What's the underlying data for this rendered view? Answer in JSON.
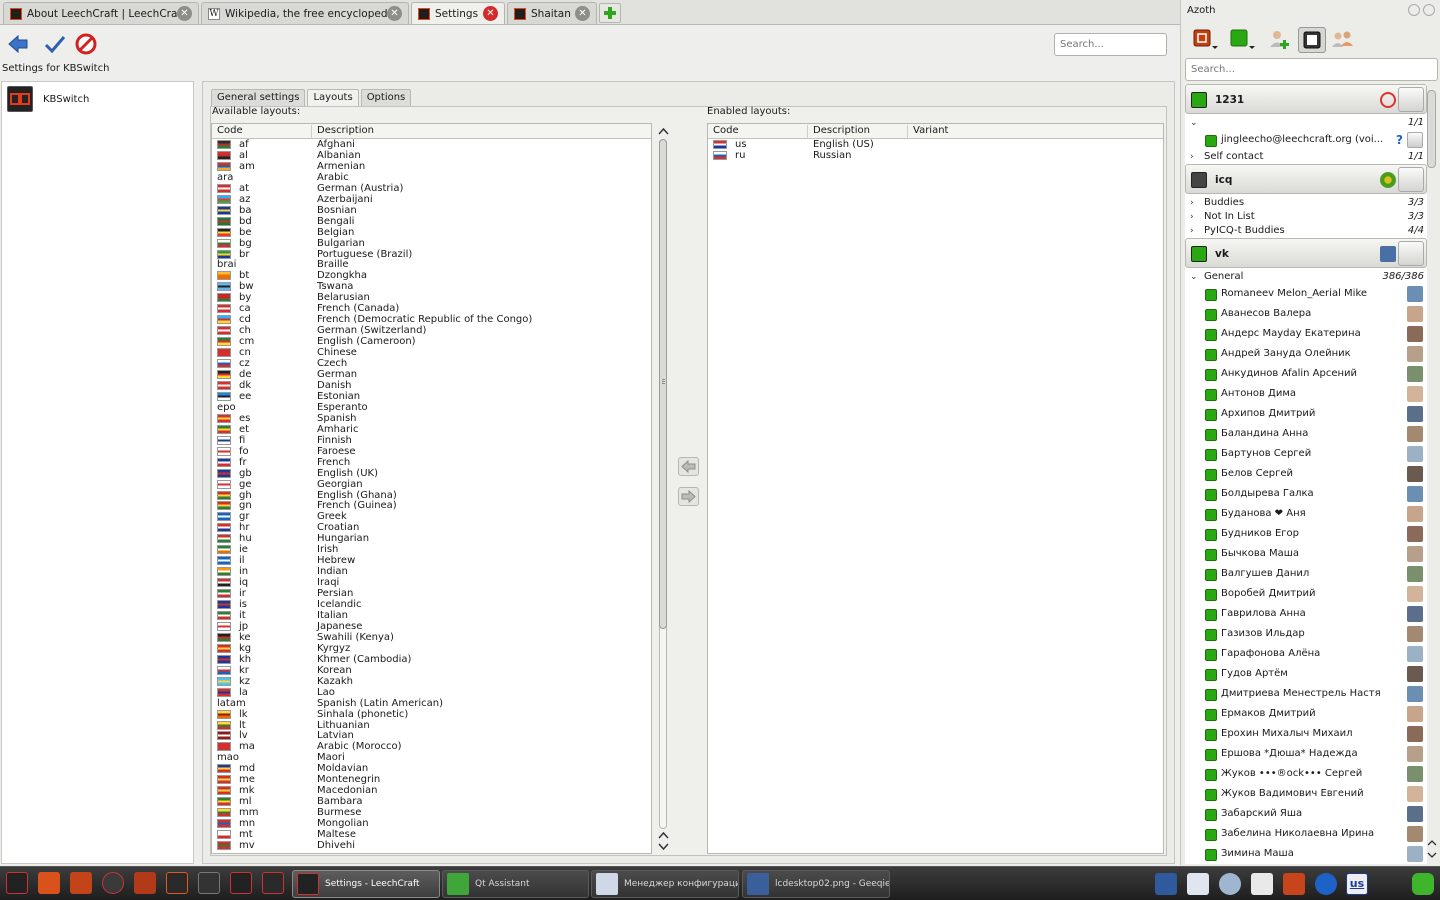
{
  "browser_tabs": [
    {
      "label": "About LeechCraft | LeechCraft"
    },
    {
      "label": "Wikipedia, the free encyclopedia"
    },
    {
      "label": "Settings"
    },
    {
      "label": "Shaitan"
    }
  ],
  "toolbar": {
    "search_placeholder": "Search..."
  },
  "settings_for": "Settings for KBSwitch",
  "left_panel": {
    "item_label": "KBSwitch"
  },
  "settings_tabs": [
    "General settings",
    "Layouts",
    "Options"
  ],
  "available": {
    "group_label": "Available layouts:",
    "columns": [
      "Code",
      "Description"
    ],
    "rows": [
      {
        "code": "af",
        "desc": "Afghani",
        "flag": [
          "#2b2b2b",
          "#c62828",
          "#2e7d32"
        ]
      },
      {
        "code": "al",
        "desc": "Albanian",
        "flag": [
          "#d32f2f",
          "#c62828",
          "#212121"
        ]
      },
      {
        "code": "am",
        "desc": "Armenian",
        "flag": [
          "#d32f2f",
          "#1565c0",
          "#f9a825"
        ]
      },
      {
        "code": "ara",
        "desc": "Arabic",
        "noflag": true
      },
      {
        "code": "at",
        "desc": "German (Austria)",
        "flag": [
          "#d32f2f",
          "#ffffff",
          "#d32f2f"
        ]
      },
      {
        "code": "az",
        "desc": "Azerbaijani",
        "flag": [
          "#29b6f6",
          "#e53935",
          "#43a047"
        ]
      },
      {
        "code": "ba",
        "desc": "Bosnian",
        "flag": [
          "#1a3a99",
          "#fdd835",
          "#1a3a99"
        ]
      },
      {
        "code": "bd",
        "desc": "Bengali",
        "flag": [
          "#1b7a32",
          "#d32f2f",
          "#1b7a32"
        ]
      },
      {
        "code": "be",
        "desc": "Belgian",
        "flag": [
          "#212121",
          "#fdd835",
          "#e53935"
        ]
      },
      {
        "code": "bg",
        "desc": "Bulgarian",
        "flag": [
          "#ffffff",
          "#2e7d32",
          "#d32f2f"
        ]
      },
      {
        "code": "br",
        "desc": "Portuguese (Brazil)",
        "flag": [
          "#2e9d3a",
          "#fdd835",
          "#1a3a99"
        ]
      },
      {
        "code": "brai",
        "desc": "Braille",
        "noflag": true
      },
      {
        "code": "bt",
        "desc": "Dzongkha",
        "flag": [
          "#fbc02d",
          "#ef6c00",
          "#ef6c00"
        ]
      },
      {
        "code": "bw",
        "desc": "Tswana",
        "flag": [
          "#64b5f6",
          "#212121",
          "#64b5f6"
        ]
      },
      {
        "code": "by",
        "desc": "Belarusian",
        "flag": [
          "#c62828",
          "#c62828",
          "#2e7d32"
        ]
      },
      {
        "code": "ca",
        "desc": "French (Canada)",
        "flag": [
          "#d32f2f",
          "#ffffff",
          "#d32f2f"
        ]
      },
      {
        "code": "cd",
        "desc": "French (Democratic Republic of the Congo)",
        "flag": [
          "#29b6f6",
          "#d32f2f",
          "#fdd835"
        ]
      },
      {
        "code": "ch",
        "desc": "German (Switzerland)",
        "flag": [
          "#d32f2f",
          "#ffffff",
          "#d32f2f"
        ]
      },
      {
        "code": "cm",
        "desc": "English (Cameroon)",
        "flag": [
          "#2e7d32",
          "#d32f2f",
          "#fdd835"
        ]
      },
      {
        "code": "cn",
        "desc": "Chinese",
        "flag": [
          "#d32f2f",
          "#d32f2f",
          "#d32f2f"
        ]
      },
      {
        "code": "cz",
        "desc": "Czech",
        "flag": [
          "#ffffff",
          "#1565c0",
          "#d32f2f"
        ]
      },
      {
        "code": "de",
        "desc": "German",
        "flag": [
          "#212121",
          "#d32f2f",
          "#fdd835"
        ]
      },
      {
        "code": "dk",
        "desc": "Danish",
        "flag": [
          "#d32f2f",
          "#ffffff",
          "#d32f2f"
        ]
      },
      {
        "code": "ee",
        "desc": "Estonian",
        "flag": [
          "#1e88e5",
          "#212121",
          "#ffffff"
        ]
      },
      {
        "code": "epo",
        "desc": "Esperanto",
        "noflag": true
      },
      {
        "code": "es",
        "desc": "Spanish",
        "flag": [
          "#d32f2f",
          "#fdd835",
          "#d32f2f"
        ]
      },
      {
        "code": "et",
        "desc": "Amharic",
        "flag": [
          "#2e7d32",
          "#fdd835",
          "#d32f2f"
        ]
      },
      {
        "code": "fi",
        "desc": "Finnish",
        "flag": [
          "#ffffff",
          "#1a3a99",
          "#ffffff"
        ]
      },
      {
        "code": "fo",
        "desc": "Faroese",
        "flag": [
          "#ffffff",
          "#d32f2f",
          "#ffffff"
        ]
      },
      {
        "code": "fr",
        "desc": "French",
        "flag": [
          "#1a3a99",
          "#ffffff",
          "#d32f2f"
        ]
      },
      {
        "code": "gb",
        "desc": "English (UK)",
        "flag": [
          "#1a3a99",
          "#d32f2f",
          "#1a3a99"
        ]
      },
      {
        "code": "ge",
        "desc": "Georgian",
        "flag": [
          "#ffffff",
          "#d32f2f",
          "#ffffff"
        ]
      },
      {
        "code": "gh",
        "desc": "English (Ghana)",
        "flag": [
          "#d32f2f",
          "#fdd835",
          "#2e7d32"
        ]
      },
      {
        "code": "gn",
        "desc": "French (Guinea)",
        "flag": [
          "#d32f2f",
          "#fdd835",
          "#2e7d32"
        ]
      },
      {
        "code": "gr",
        "desc": "Greek",
        "flag": [
          "#1565c0",
          "#ffffff",
          "#1565c0"
        ]
      },
      {
        "code": "hr",
        "desc": "Croatian",
        "flag": [
          "#d32f2f",
          "#ffffff",
          "#1a3a99"
        ]
      },
      {
        "code": "hu",
        "desc": "Hungarian",
        "flag": [
          "#d32f2f",
          "#ffffff",
          "#2e7d32"
        ]
      },
      {
        "code": "ie",
        "desc": "Irish",
        "flag": [
          "#2e7d32",
          "#ffffff",
          "#ef6c00"
        ]
      },
      {
        "code": "il",
        "desc": "Hebrew",
        "flag": [
          "#1565c0",
          "#ffffff",
          "#1565c0"
        ]
      },
      {
        "code": "in",
        "desc": "Indian",
        "flag": [
          "#ff9800",
          "#ffffff",
          "#2e7d32"
        ]
      },
      {
        "code": "iq",
        "desc": "Iraqi",
        "flag": [
          "#d32f2f",
          "#ffffff",
          "#212121"
        ]
      },
      {
        "code": "ir",
        "desc": "Persian",
        "flag": [
          "#2e7d32",
          "#ffffff",
          "#d32f2f"
        ]
      },
      {
        "code": "is",
        "desc": "Icelandic",
        "flag": [
          "#1a3a99",
          "#d32f2f",
          "#1a3a99"
        ]
      },
      {
        "code": "it",
        "desc": "Italian",
        "flag": [
          "#2e7d32",
          "#ffffff",
          "#d32f2f"
        ]
      },
      {
        "code": "jp",
        "desc": "Japanese",
        "flag": [
          "#ffffff",
          "#d32f2f",
          "#ffffff"
        ]
      },
      {
        "code": "ke",
        "desc": "Swahili (Kenya)",
        "flag": [
          "#212121",
          "#d32f2f",
          "#2e7d32"
        ]
      },
      {
        "code": "kg",
        "desc": "Kyrgyz",
        "flag": [
          "#d32f2f",
          "#fdd835",
          "#d32f2f"
        ]
      },
      {
        "code": "kh",
        "desc": "Khmer (Cambodia)",
        "flag": [
          "#1a3a99",
          "#d32f2f",
          "#1a3a99"
        ]
      },
      {
        "code": "kr",
        "desc": "Korean",
        "flag": [
          "#ffffff",
          "#d32f2f",
          "#1565c0"
        ]
      },
      {
        "code": "kz",
        "desc": "Kazakh",
        "flag": [
          "#4fc3f7",
          "#fdd835",
          "#4fc3f7"
        ]
      },
      {
        "code": "la",
        "desc": "Lao",
        "flag": [
          "#d32f2f",
          "#1a3a99",
          "#d32f2f"
        ]
      },
      {
        "code": "latam",
        "desc": "Spanish (Latin American)",
        "noflag": true
      },
      {
        "code": "lk",
        "desc": "Sinhala (phonetic)",
        "flag": [
          "#fdd835",
          "#8d1b1b",
          "#ef6c00"
        ]
      },
      {
        "code": "lt",
        "desc": "Lithuanian",
        "flag": [
          "#fdd835",
          "#2e7d32",
          "#d32f2f"
        ]
      },
      {
        "code": "lv",
        "desc": "Latvian",
        "flag": [
          "#8d1b1b",
          "#ffffff",
          "#8d1b1b"
        ]
      },
      {
        "code": "ma",
        "desc": "Arabic (Morocco)",
        "flag": [
          "#d32f2f",
          "#d32f2f",
          "#d32f2f"
        ]
      },
      {
        "code": "mao",
        "desc": "Maori",
        "noflag": true
      },
      {
        "code": "md",
        "desc": "Moldavian",
        "flag": [
          "#1a3a99",
          "#fdd835",
          "#d32f2f"
        ]
      },
      {
        "code": "me",
        "desc": "Montenegrin",
        "flag": [
          "#d32f2f",
          "#fdd835",
          "#d32f2f"
        ]
      },
      {
        "code": "mk",
        "desc": "Macedonian",
        "flag": [
          "#d32f2f",
          "#fdd835",
          "#d32f2f"
        ]
      },
      {
        "code": "ml",
        "desc": "Bambara",
        "flag": [
          "#2e7d32",
          "#fdd835",
          "#d32f2f"
        ]
      },
      {
        "code": "mm",
        "desc": "Burmese",
        "flag": [
          "#fdd835",
          "#2e7d32",
          "#d32f2f"
        ]
      },
      {
        "code": "mn",
        "desc": "Mongolian",
        "flag": [
          "#d32f2f",
          "#1565c0",
          "#d32f2f"
        ]
      },
      {
        "code": "mt",
        "desc": "Maltese",
        "flag": [
          "#ffffff",
          "#ffffff",
          "#d32f2f"
        ]
      },
      {
        "code": "mv",
        "desc": "Dhivehi",
        "flag": [
          "#d32f2f",
          "#2e7d32",
          "#d32f2f"
        ]
      }
    ]
  },
  "enabled": {
    "group_label": "Enabled layouts:",
    "columns": [
      "Code",
      "Description",
      "Variant"
    ],
    "rows": [
      {
        "code": "us",
        "desc": "English (US)",
        "flag": [
          "#d32f2f",
          "#ffffff",
          "#1a3a99"
        ]
      },
      {
        "code": "ru",
        "desc": "Russian",
        "flag": [
          "#ffffff",
          "#1565c0",
          "#d32f2f"
        ]
      }
    ]
  },
  "azoth": {
    "title": "Azoth",
    "search_placeholder": "Search...",
    "accounts": [
      {
        "name": "1231",
        "status_color": "#29a812",
        "groups": [
          {
            "name": "",
            "count": "1/1",
            "expanded": true,
            "contacts": [
              {
                "name": "jingleecho@leechcraft.org (voi...",
                "extra": "?"
              }
            ]
          },
          {
            "name": "Self contact",
            "count": "1/1",
            "expanded": false,
            "contacts": []
          }
        ]
      },
      {
        "name": "icq",
        "status_color": "#444444",
        "groups": [
          {
            "name": "Buddies",
            "count": "3/3",
            "expanded": false,
            "contacts": []
          },
          {
            "name": "Not In List",
            "count": "3/3",
            "expanded": false,
            "contacts": []
          },
          {
            "name": "PyICQ-t Buddies",
            "count": "4/4",
            "expanded": false,
            "contacts": []
          }
        ]
      },
      {
        "name": "vk",
        "status_color": "#29a812",
        "groups": [
          {
            "name": "General",
            "count": "386/386",
            "expanded": true,
            "contacts": [
              {
                "name": "Romaneev Melon_Aerial Mike"
              },
              {
                "name": "Аванесов Валера"
              },
              {
                "name": "Андерс Mayday Екатерина"
              },
              {
                "name": "Андрей Зануда Олейник"
              },
              {
                "name": "Анкудинов Afalin Арсений"
              },
              {
                "name": "Антонов Дима"
              },
              {
                "name": "Архипов Дмитрий"
              },
              {
                "name": "Баландина Анна"
              },
              {
                "name": "Бартунов Сергей"
              },
              {
                "name": "Белов Сергей"
              },
              {
                "name": "Болдырева Галка"
              },
              {
                "name": "Буданова ❤ Аня"
              },
              {
                "name": "Будников Егор"
              },
              {
                "name": "Бычкова Маша"
              },
              {
                "name": "Валгушев Данил"
              },
              {
                "name": "Воробей Дмитрий"
              },
              {
                "name": "Гаврилова Анна"
              },
              {
                "name": "Газизов Ильдар"
              },
              {
                "name": "Гарафонова Алёна"
              },
              {
                "name": "Гудов Артём"
              },
              {
                "name": "Дмитриева Менестрель Настя"
              },
              {
                "name": "Ермаков Дмитрий"
              },
              {
                "name": "Ерохин Михалыч Михаил"
              },
              {
                "name": "Ершова *Дюша* Надежда"
              },
              {
                "name": "Жуков •••®ock••• Сергей"
              },
              {
                "name": "Жуков Вадимович Евгений"
              },
              {
                "name": "Забарский Яша"
              },
              {
                "name": "Забелина Николаевна Ирина"
              },
              {
                "name": "Зимина Маша"
              }
            ]
          }
        ]
      }
    ]
  },
  "taskbar": {
    "tasks": [
      {
        "label": "Settings - LeechCraft",
        "active": true
      },
      {
        "label": "Qt Assistant",
        "active": false
      },
      {
        "label": "Менеджер конфигурации Op...",
        "active": false
      },
      {
        "label": "lcdesktop02.png - Geeqie",
        "active": false
      }
    ],
    "kb_indicator": "us"
  }
}
